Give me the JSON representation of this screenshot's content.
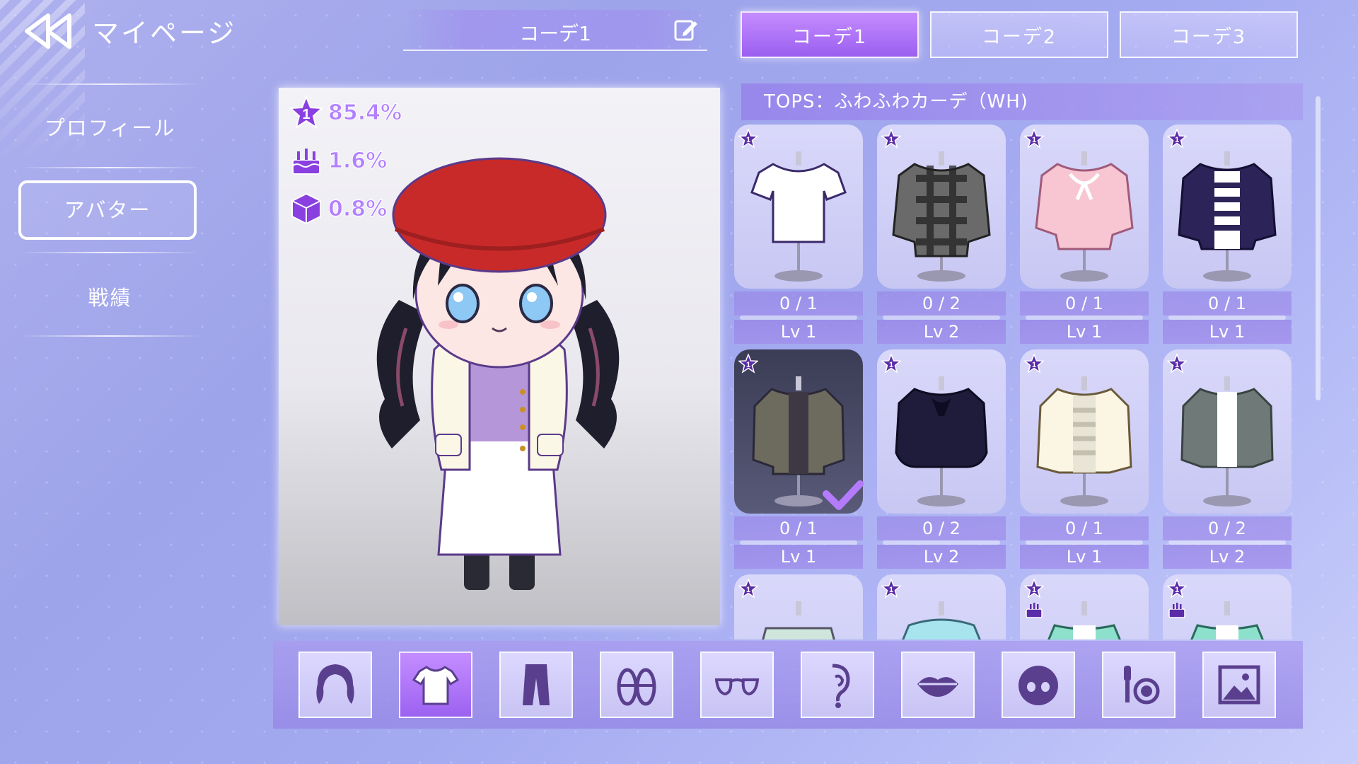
{
  "header": {
    "page_title": "マイページ",
    "coord_name": "コーデ1",
    "tabs": [
      {
        "label": "コーデ1",
        "active": true
      },
      {
        "label": "コーデ2",
        "active": false
      },
      {
        "label": "コーデ3",
        "active": false
      }
    ]
  },
  "sidebar": {
    "items": [
      {
        "label": "プロフィール",
        "active": false
      },
      {
        "label": "アバター",
        "active": true
      },
      {
        "label": "戦績",
        "active": false
      }
    ]
  },
  "preview": {
    "stats": [
      {
        "icon": "star-rank-icon",
        "value": "85.4%"
      },
      {
        "icon": "cake-icon",
        "value": "1.6%"
      },
      {
        "icon": "cube-icon",
        "value": "0.8%"
      }
    ]
  },
  "category": {
    "label": "TOPS：ふわふわカーデ（WH)"
  },
  "items": [
    {
      "name": "white-tshirt",
      "count": "0 / 1",
      "level": "Lv 1",
      "selected": false
    },
    {
      "name": "plaid-shirt",
      "count": "0 / 2",
      "level": "Lv 2",
      "selected": false
    },
    {
      "name": "pink-ribbon-blouse",
      "count": "0 / 1",
      "level": "Lv 1",
      "selected": false
    },
    {
      "name": "navy-jacket-striped",
      "count": "0 / 1",
      "level": "Lv 1",
      "selected": false
    },
    {
      "name": "fluffy-cardigan",
      "count": "0 / 1",
      "level": "Lv 1",
      "selected": true
    },
    {
      "name": "black-frill-blouse",
      "count": "0 / 2",
      "level": "Lv 2",
      "selected": false
    },
    {
      "name": "cream-jacket",
      "count": "0 / 1",
      "level": "Lv 1",
      "selected": false
    },
    {
      "name": "gray-cardigan",
      "count": "0 / 2",
      "level": "Lv 2",
      "selected": false
    },
    {
      "name": "mint-knit",
      "count": "",
      "level": "",
      "selected": false
    },
    {
      "name": "aqua-puffer",
      "count": "",
      "level": "",
      "selected": false
    },
    {
      "name": "mint-tee",
      "count": "",
      "level": "",
      "selected": false
    },
    {
      "name": "mint-tee-2",
      "count": "",
      "level": "",
      "selected": false
    }
  ],
  "toolbar": [
    {
      "icon": "hair-icon",
      "active": false
    },
    {
      "icon": "tshirt-icon",
      "active": true
    },
    {
      "icon": "pants-icon",
      "active": false
    },
    {
      "icon": "shoes-icon",
      "active": false
    },
    {
      "icon": "glasses-icon",
      "active": false
    },
    {
      "icon": "ear-accessory-icon",
      "active": false
    },
    {
      "icon": "lips-icon",
      "active": false
    },
    {
      "icon": "face-icon",
      "active": false
    },
    {
      "icon": "makeup-icon",
      "active": false
    },
    {
      "icon": "background-image-icon",
      "active": false
    }
  ],
  "colors": {
    "accent": "#9b5ff0",
    "stat_text": "#b280ff",
    "beret": "#c82a2a",
    "hair": "#1e1e2c"
  }
}
